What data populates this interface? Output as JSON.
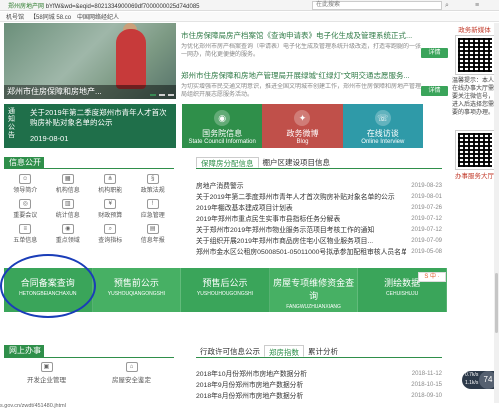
{
  "browser": {
    "url_domain": "郑州房地产网",
    "url_rest": "bYfW&wd=&eqid=8021334900069df7000000025d74d085",
    "search_placeholder": "在此搜索",
    "tabs": [
      "机号馆",
      "【58同城 58.co",
      "中国网络经纪人"
    ]
  },
  "banner": {
    "caption": "郑州市住房保障和房地产..."
  },
  "news": [
    {
      "title": "市住房保障局房产档案馆《查询申请表》电子化生成及管理系统正式...",
      "desc": "为优化郑州市房产档案查询（申请表）电子化生成及管理系统升级改造，打造零跑腿的一张一网办，简化更便捷的服务。",
      "btn": "详情"
    },
    {
      "title": "郑州市住房保障和房地产管理局开展绿城“红绿灯”文明交通志愿服务...",
      "desc": "为切实增强市民交通文明意识，推进全国文明城市创建工作，郑州市住房保障和房地产管理局组织开展志愿服务活动。",
      "btn": "详情"
    }
  ],
  "notice": {
    "label": "通知公告",
    "text": "关于2019年第二季度郑州市青年人才首次购房补贴对象名单的公示",
    "date": "2019-08-01"
  },
  "tiles": [
    {
      "cn": "国务院信息",
      "en": "State Council Information",
      "icon": "◉",
      "color": "#2f8f4a"
    },
    {
      "cn": "政务微博",
      "en": "Blog",
      "icon": "✦",
      "color": "#c0504a"
    },
    {
      "cn": "在线访谈",
      "en": "Online Interview",
      "icon": "☏",
      "color": "#2f9aa8"
    }
  ],
  "sidebar": {
    "qr1_title": "政务新媒体",
    "qr1_desc": "温馨提示：本人在线办事大厅需要关注微信号，进入后选择您需要的事项办理。",
    "qr2_title": "办事服务大厅"
  },
  "info": {
    "header": "信息公开",
    "items": [
      "领导简介",
      "机构信息",
      "机构职能",
      "政策法规",
      "重要会议",
      "统计信息",
      "财政预算",
      "应急管理",
      "五单信息",
      "重点领域",
      "查询指标",
      "信息年报"
    ]
  },
  "housing": {
    "tabs": [
      "保障房分配信息",
      "棚户区建设项目信息"
    ],
    "rows": [
      {
        "t": "房地产消费警示",
        "d": "2019-08-23"
      },
      {
        "t": "关于2019年第二季度郑州市青年人才首次购房补贴对象名单的公示",
        "d": "2019-08-01"
      },
      {
        "t": "2019年棚改基本建成项目计划表",
        "d": "2019-07-26"
      },
      {
        "t": "2019年郑州市重点民生实事市县指标任务分解表",
        "d": "2019-07-12"
      },
      {
        "t": "关于郑州市2019年郑州市物业服务示范项目考核工作的通知",
        "d": "2019-07-12"
      },
      {
        "t": "关于组织开展2019年郑州市商品房住宅小区物业服务项目...",
        "d": "2019-07-09"
      },
      {
        "t": "郑州市金水区公租房05008501-05011000号拟承参加配租审核人员名单公示",
        "d": "2019-05-08"
      }
    ]
  },
  "band": [
    {
      "cn": "合同备案查询",
      "en": "HETONGBEIANCHAXUN"
    },
    {
      "cn": "预售前公示",
      "en": "YUSHOUQIANGONGSHI"
    },
    {
      "cn": "预售后公示",
      "en": "YUSHOUHOUGONGSHI"
    },
    {
      "cn": "房屋专项维修资金查询",
      "en": "FANGWUZHUANXIANG"
    },
    {
      "cn": "测绘数据",
      "en": "CEHUISHUJU"
    }
  ],
  "badge": "S 中 ·",
  "office": {
    "header": "网上办事",
    "items": [
      "开发企业管理",
      "房屋安全鉴定"
    ]
  },
  "stats": {
    "tabs": [
      "行政许可信息公示",
      "郑房指数",
      "累计分析"
    ],
    "rows": [
      {
        "t": "2018年10月份郑州市房地产数据分析",
        "d": "2018-11-12"
      },
      {
        "t": "2018年9月份郑州市房地产数据分析",
        "d": "2018-10-15"
      },
      {
        "t": "2018年8月份郑州市房地产数据分析",
        "d": "2018-09-10"
      }
    ]
  },
  "float_widget": {
    "l1": "0.7k/s",
    "l2": "1.1k/s",
    "pct": "74"
  },
  "status_url": "s.gov.cn/zwdt/451480.jhtml"
}
